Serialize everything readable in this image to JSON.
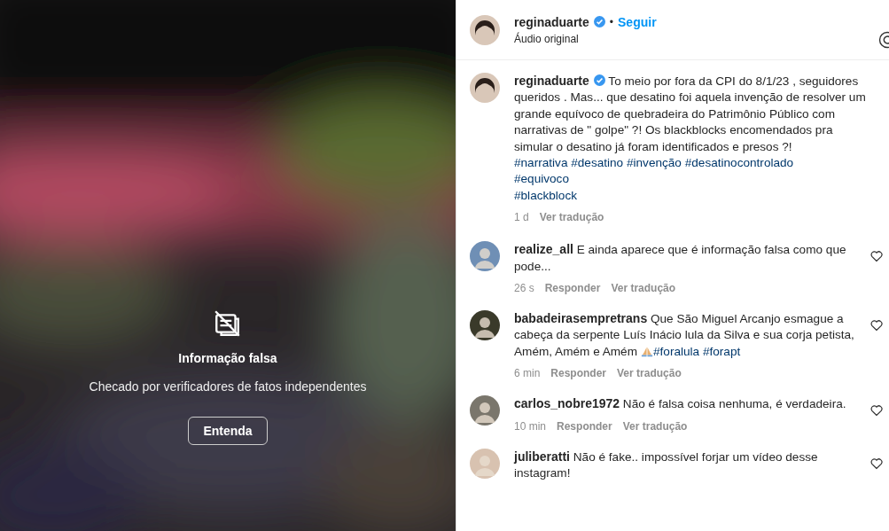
{
  "video": {
    "notice": {
      "title": "Informação falsa",
      "text": "Checado por verificadores de fatos independentes",
      "button": "Entenda"
    }
  },
  "header": {
    "username": "reginaduarte",
    "verified": true,
    "separator": "•",
    "follow": "Seguir",
    "audio": "Áudio original"
  },
  "caption": {
    "username": "reginaduarte",
    "verified": true,
    "text": "To meio por fora da CPI do 8/1/23 , seguidores queridos . Mas... que desatino foi aquela invenção de resolver um grande equívoco de quebradeira do Patrimônio Público com narrativas de \" golpe\" ?! Os blackblocks encomendados pra simular o desatino já foram identificados e presos ?!",
    "hashtag_lines": [
      "#narrativa #desatino #invenção #desatinocontrolado",
      "#equivoco",
      "#blackblock"
    ],
    "time": "1 d",
    "translate": "Ver tradução"
  },
  "comments": [
    {
      "username": "realize_all",
      "text": "E ainda aparece que é informação falsa como que pode...",
      "emoji": false,
      "time": "26 s",
      "reply": "Responder",
      "translate": "Ver tradução"
    },
    {
      "username": "babadeirasempretrans",
      "text": "Que São Miguel Arcanjo esmague a cabeça da serpente Luís Inácio lula da Silva e sua corja petista, Amém, Amém e Amém",
      "emoji": true,
      "hashtags": "#foralula #forapt",
      "time": "6 min",
      "reply": "Responder",
      "translate": "Ver tradução"
    },
    {
      "username": "carlos_nobre1972",
      "text": "Não é falsa coisa nenhuma, é verdadeira.",
      "emoji": false,
      "time": "10 min",
      "reply": "Responder",
      "translate": "Ver tradução"
    },
    {
      "username": "juliberatti",
      "text": "Não é fake.. impossível forjar um vídeo desse instagram!",
      "emoji": false
    }
  ]
}
